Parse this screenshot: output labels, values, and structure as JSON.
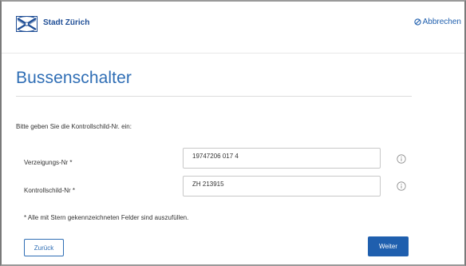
{
  "header": {
    "brand": "Stadt Zürich",
    "cancel_label": "Abbrechen",
    "brand_color": "#1f4e96",
    "link_color": "#1f5fae"
  },
  "main": {
    "title": "Bussenschalter",
    "instruction": "Bitte geben Sie die Kontrollschild-Nr. ein:",
    "fields": [
      {
        "label": "Verzeigungs-Nr *",
        "value": "19747206 017 4"
      },
      {
        "label": "Kontrollschild-Nr *",
        "value": "ZH 213915"
      }
    ],
    "note": "* Alle mit Stern gekennzeichneten Felder sind auszufüllen.",
    "back_label": "Zurück",
    "next_label": "Weiter",
    "accent_color": "#2f6eb5"
  },
  "icons": [
    "city-logo-icon",
    "cancel-circle-icon",
    "info-icon"
  ]
}
